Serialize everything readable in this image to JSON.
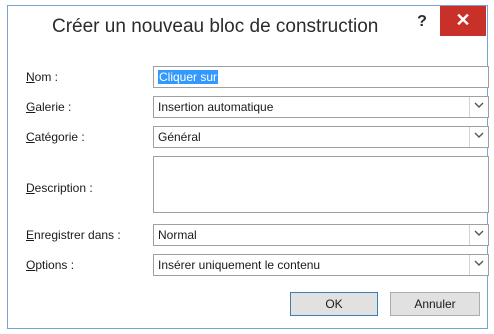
{
  "dialog": {
    "title": "Créer un nouveau bloc de construction",
    "help_label": "?",
    "close_label": "✕"
  },
  "fields": {
    "nom": {
      "label_key": "N",
      "label_rest": "om :",
      "value": "Cliquer sur"
    },
    "galerie": {
      "label_key": "G",
      "label_rest": "alerie :",
      "value": "Insertion automatique"
    },
    "categorie": {
      "label_key": "C",
      "label_rest": "atégorie :",
      "value": "Général"
    },
    "description": {
      "label_key": "D",
      "label_rest": "escription :",
      "value": ""
    },
    "enregistrer": {
      "label_key": "E",
      "label_rest": "nregistrer dans :",
      "value": "Normal"
    },
    "options": {
      "label_key": "O",
      "label_rest": "ptions :",
      "value": "Insérer uniquement le contenu"
    }
  },
  "buttons": {
    "ok_label": "OK",
    "cancel_label": "Annuler"
  },
  "icons": {
    "dropdown": "chevron-down-icon"
  }
}
